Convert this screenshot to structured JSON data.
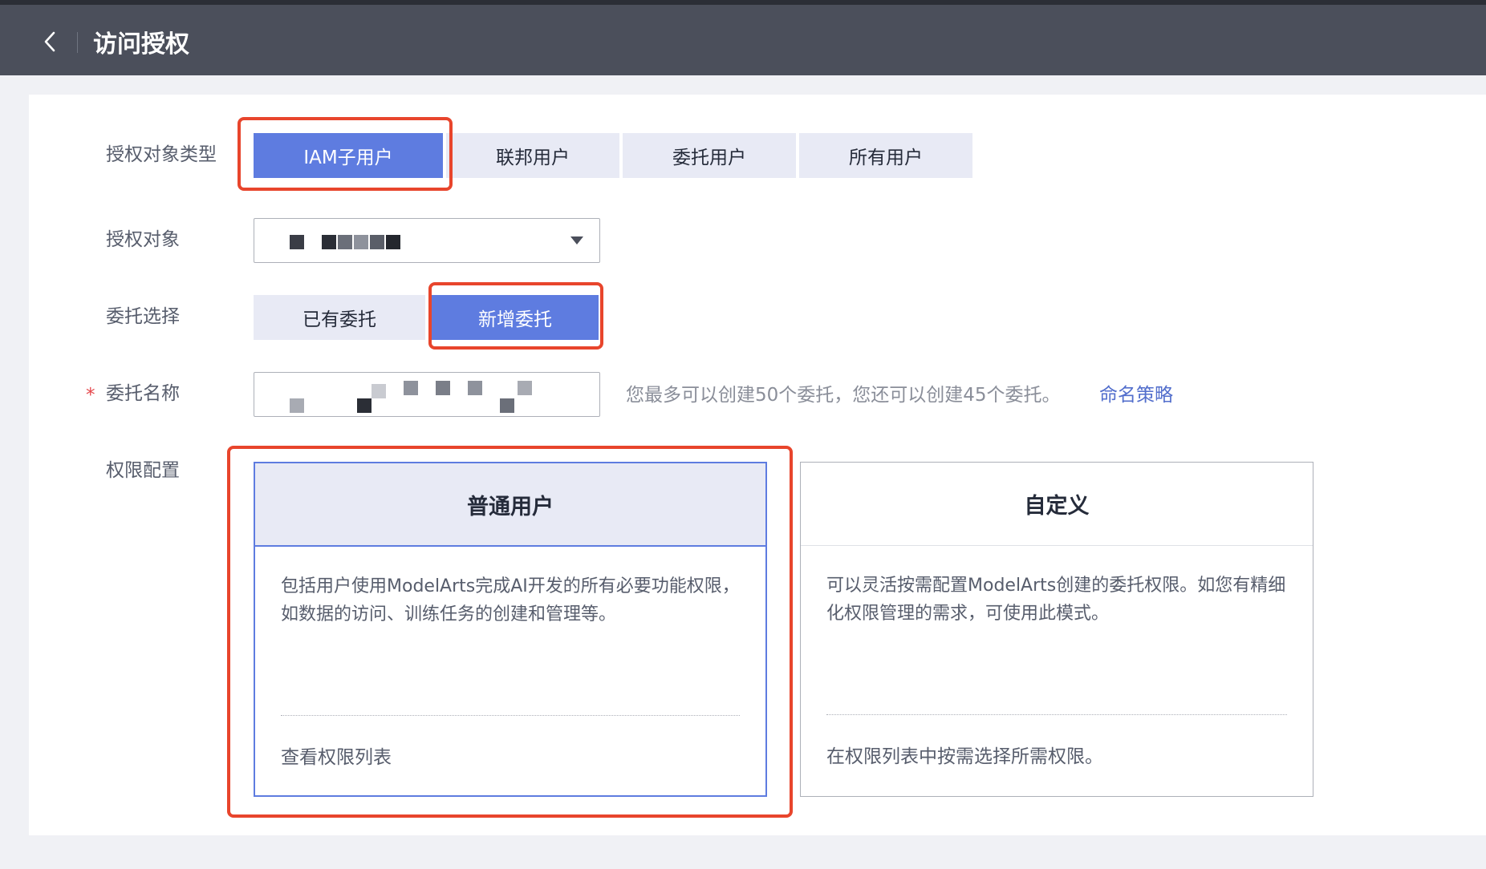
{
  "header": {
    "title": "访问授权",
    "back_icon": "chevron-left-icon"
  },
  "form": {
    "subject_type": {
      "label": "授权对象类型",
      "options": [
        "IAM子用户",
        "联邦用户",
        "委托用户",
        "所有用户"
      ],
      "selected": "IAM子用户"
    },
    "subject": {
      "label": "授权对象",
      "value_redacted": true,
      "dropdown_icon": "caret-down-icon"
    },
    "agency_choice": {
      "label": "委托选择",
      "options": [
        "已有委托",
        "新增委托"
      ],
      "selected": "新增委托"
    },
    "agency_name": {
      "label": "委托名称",
      "required_mark": "*",
      "value_redacted": true,
      "hint": "您最多可以创建50个委托，您还可以创建45个委托。",
      "hint_link": "命名策略"
    },
    "permission": {
      "label": "权限配置",
      "cards": [
        {
          "title": "普通用户",
          "desc": "包括用户使用ModelArts完成AI开发的所有必要功能权限，如数据的访问、训练任务的创建和管理等。",
          "footer": "查看权限列表",
          "footer_is_link": true,
          "selected": true
        },
        {
          "title": "自定义",
          "desc": "可以灵活按需配置ModelArts创建的委托权限。如您有精细化权限管理的需求，可使用此模式。",
          "footer": "在权限列表中按需选择所需权限。",
          "footer_is_link": false,
          "selected": false
        }
      ]
    }
  },
  "colors": {
    "accent": "#5e7ce0",
    "highlight": "#e8452c",
    "header_bg": "#4b4f5b",
    "segment_bg": "#e8eaf5"
  }
}
